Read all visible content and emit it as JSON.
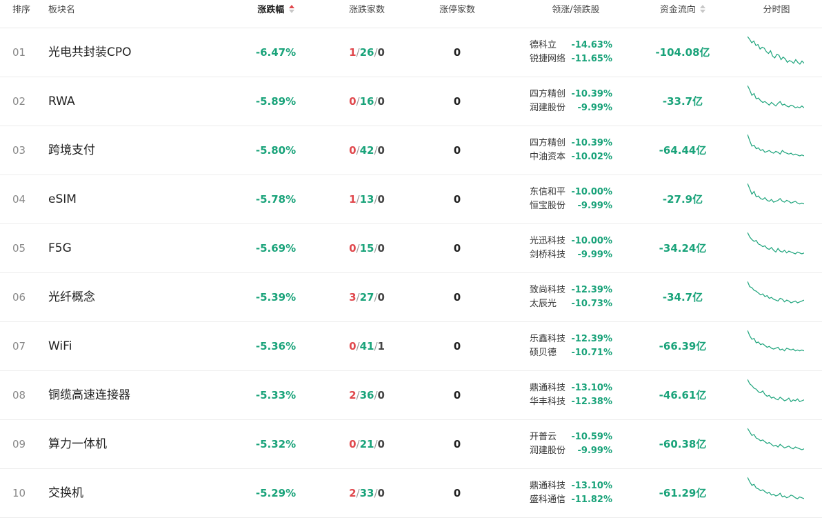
{
  "header": {
    "rank": "排序",
    "name": "板块名",
    "change": "涨跌幅",
    "updown": "涨跌家数",
    "limitup": "涨停家数",
    "leaders": "领涨/领跌股",
    "flow": "资金流向",
    "spark": "分时图"
  },
  "colors": {
    "up": "#e0484d",
    "down": "#1aa37a",
    "text": "#222222"
  },
  "rows": [
    {
      "rank": "01",
      "name": "光电共封装CPO",
      "change": "-6.47%",
      "up": "1",
      "down": "26",
      "flat": "0",
      "limit": "0",
      "lead1": "德科立",
      "pct1": "-14.63%",
      "lead2": "锐捷网络",
      "pct2": "-11.65%",
      "flow": "-104.08亿"
    },
    {
      "rank": "02",
      "name": "RWA",
      "change": "-5.89%",
      "up": "0",
      "down": "16",
      "flat": "0",
      "limit": "0",
      "lead1": "四方精创",
      "pct1": "-10.39%",
      "lead2": "润建股份",
      "pct2": "-9.99%",
      "flow": "-33.7亿"
    },
    {
      "rank": "03",
      "name": "跨境支付",
      "change": "-5.80%",
      "up": "0",
      "down": "42",
      "flat": "0",
      "limit": "0",
      "lead1": "四方精创",
      "pct1": "-10.39%",
      "lead2": "中油资本",
      "pct2": "-10.02%",
      "flow": "-64.44亿"
    },
    {
      "rank": "04",
      "name": "eSIM",
      "change": "-5.78%",
      "up": "1",
      "down": "13",
      "flat": "0",
      "limit": "0",
      "lead1": "东信和平",
      "pct1": "-10.00%",
      "lead2": "恒宝股份",
      "pct2": "-9.99%",
      "flow": "-27.9亿"
    },
    {
      "rank": "05",
      "name": "F5G",
      "change": "-5.69%",
      "up": "0",
      "down": "15",
      "flat": "0",
      "limit": "0",
      "lead1": "光迅科技",
      "pct1": "-10.00%",
      "lead2": "剑桥科技",
      "pct2": "-9.99%",
      "flow": "-34.24亿"
    },
    {
      "rank": "06",
      "name": "光纤概念",
      "change": "-5.39%",
      "up": "3",
      "down": "27",
      "flat": "0",
      "limit": "0",
      "lead1": "致尚科技",
      "pct1": "-12.39%",
      "lead2": "太辰光",
      "pct2": "-10.73%",
      "flow": "-34.7亿"
    },
    {
      "rank": "07",
      "name": "WiFi",
      "change": "-5.36%",
      "up": "0",
      "down": "41",
      "flat": "1",
      "limit": "0",
      "lead1": "乐鑫科技",
      "pct1": "-12.39%",
      "lead2": "硕贝德",
      "pct2": "-10.71%",
      "flow": "-66.39亿"
    },
    {
      "rank": "08",
      "name": "铜缆高速连接器",
      "change": "-5.33%",
      "up": "2",
      "down": "36",
      "flat": "0",
      "limit": "0",
      "lead1": "鼎通科技",
      "pct1": "-13.10%",
      "lead2": "华丰科技",
      "pct2": "-12.38%",
      "flow": "-46.61亿"
    },
    {
      "rank": "09",
      "name": "算力一体机",
      "change": "-5.32%",
      "up": "0",
      "down": "21",
      "flat": "0",
      "limit": "0",
      "lead1": "开普云",
      "pct1": "-10.59%",
      "lead2": "润建股份",
      "pct2": "-9.99%",
      "flow": "-60.38亿"
    },
    {
      "rank": "10",
      "name": "交换机",
      "change": "-5.29%",
      "up": "2",
      "down": "33",
      "flat": "0",
      "limit": "0",
      "lead1": "鼎通科技",
      "pct1": "-13.10%",
      "lead2": "盛科通信",
      "pct2": "-11.82%",
      "flow": "-61.29亿"
    }
  ]
}
